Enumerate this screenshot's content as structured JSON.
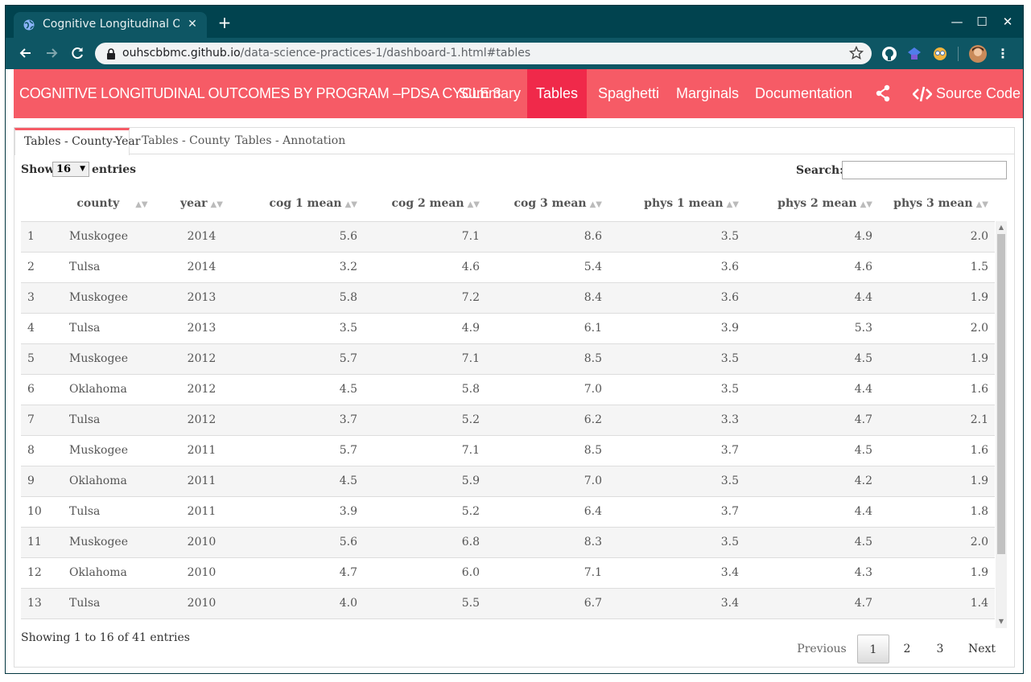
{
  "browser": {
    "tab_title": "Cognitive Longitudinal Outcomes",
    "url_host": "ouhscbbmc.github.io",
    "url_path": "/data-science-practices-1/dashboard-1.html#tables"
  },
  "navbar": {
    "brand": "COGNITIVE LONGITUDINAL OUTCOMES BY PROGRAM –PDSA CYCLE 3",
    "items": [
      {
        "label": "Summary",
        "active": false
      },
      {
        "label": "Tables",
        "active": true
      },
      {
        "label": "Spaghetti",
        "active": false
      },
      {
        "label": "Marginals",
        "active": false
      },
      {
        "label": "Documentation",
        "active": false
      }
    ],
    "source_code_label": "Source Code",
    "accent_color": "#f65b66",
    "active_color": "#f0294a"
  },
  "tabs": [
    {
      "label": "Tables - County-Year",
      "active": true
    },
    {
      "label": "Tables - County",
      "active": false
    },
    {
      "label": "Tables - Annotation",
      "active": false
    }
  ],
  "controls": {
    "show_label": "Show",
    "page_length": "16",
    "entries_label": "entries",
    "search_label": "Search:",
    "search_value": ""
  },
  "table": {
    "columns": [
      "",
      "county",
      "year",
      "cog 1 mean",
      "cog 2 mean",
      "cog 3 mean",
      "phys 1 mean",
      "phys 2 mean",
      "phys 3 mean"
    ],
    "rows": [
      [
        "1",
        "Muskogee",
        "2014",
        "5.6",
        "7.1",
        "8.6",
        "3.5",
        "4.9",
        "2.0"
      ],
      [
        "2",
        "Tulsa",
        "2014",
        "3.2",
        "4.6",
        "5.4",
        "3.6",
        "4.6",
        "1.5"
      ],
      [
        "3",
        "Muskogee",
        "2013",
        "5.8",
        "7.2",
        "8.4",
        "3.6",
        "4.4",
        "1.9"
      ],
      [
        "4",
        "Tulsa",
        "2013",
        "3.5",
        "4.9",
        "6.1",
        "3.9",
        "5.3",
        "2.0"
      ],
      [
        "5",
        "Muskogee",
        "2012",
        "5.7",
        "7.1",
        "8.5",
        "3.5",
        "4.5",
        "1.9"
      ],
      [
        "6",
        "Oklahoma",
        "2012",
        "4.5",
        "5.8",
        "7.0",
        "3.5",
        "4.4",
        "1.6"
      ],
      [
        "7",
        "Tulsa",
        "2012",
        "3.7",
        "5.2",
        "6.2",
        "3.3",
        "4.7",
        "2.1"
      ],
      [
        "8",
        "Muskogee",
        "2011",
        "5.7",
        "7.1",
        "8.5",
        "3.7",
        "4.5",
        "1.6"
      ],
      [
        "9",
        "Oklahoma",
        "2011",
        "4.5",
        "5.9",
        "7.0",
        "3.5",
        "4.2",
        "1.9"
      ],
      [
        "10",
        "Tulsa",
        "2011",
        "3.9",
        "5.2",
        "6.4",
        "3.7",
        "4.4",
        "1.8"
      ],
      [
        "11",
        "Muskogee",
        "2010",
        "5.6",
        "6.8",
        "8.3",
        "3.5",
        "4.5",
        "2.0"
      ],
      [
        "12",
        "Oklahoma",
        "2010",
        "4.7",
        "6.0",
        "7.1",
        "3.4",
        "4.3",
        "1.9"
      ],
      [
        "13",
        "Tulsa",
        "2010",
        "4.0",
        "5.5",
        "6.7",
        "3.4",
        "4.7",
        "1.4"
      ]
    ]
  },
  "footer": {
    "info": "Showing 1 to 16 of 41 entries",
    "previous": "Previous",
    "pages": [
      "1",
      "2",
      "3"
    ],
    "current_page": "1",
    "next": "Next"
  }
}
